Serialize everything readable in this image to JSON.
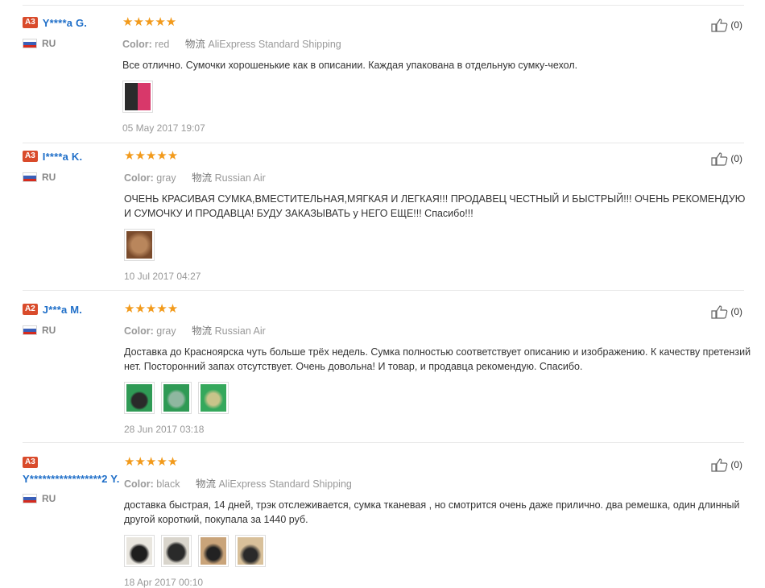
{
  "reviews": [
    {
      "level": "A3",
      "name": "Y****a G.",
      "country": "RU",
      "stars": "★★★★★",
      "color_label": "Color:",
      "color_value": "red",
      "shipping_label": "物流",
      "shipping_value": "AliExpress Standard Shipping",
      "text": "Все отлично. Сумочки хорошенькие как в описании. Каждая упакована в отдельную сумку-чехол.",
      "date": "05 May 2017 19:07",
      "helpful": "(0)"
    },
    {
      "level": "A3",
      "name": "I****a K.",
      "country": "RU",
      "stars": "★★★★★",
      "color_label": "Color:",
      "color_value": "gray",
      "shipping_label": "物流",
      "shipping_value": "Russian Air",
      "text": "ОЧЕНЬ КРАСИВАЯ СУМКА,ВМЕСТИТЕЛЬНАЯ,МЯГКАЯ И ЛЕГКАЯ!!! ПРОДАВЕЦ ЧЕСТНЫЙ И БЫСТРЫЙ!!! ОЧЕНЬ РЕКОМЕНДУЮ И СУМОЧКУ И ПРОДАВЦА! БУДУ ЗАКАЗЫВАТЬ у НЕГО ЕЩЕ!!! Спасибо!!!",
      "date": "10 Jul 2017 04:27",
      "helpful": "(0)"
    },
    {
      "level": "A2",
      "name": "J***a M.",
      "country": "RU",
      "stars": "★★★★★",
      "color_label": "Color:",
      "color_value": "gray",
      "shipping_label": "物流",
      "shipping_value": "Russian Air",
      "text": "Доставка до Красноярска чуть больше трёх недель. Сумка полностью соответствует описанию и изображению. К качеству претензий нет. Посторонний запах отсутствует. Очень довольна! И товар, и продавца рекомендую. Спасибо.",
      "date": "28 Jun 2017 03:18",
      "helpful": "(0)"
    },
    {
      "level": "A3",
      "name": "Y*****************2 Y.",
      "country": "RU",
      "stars": "★★★★★",
      "color_label": "Color:",
      "color_value": "black",
      "shipping_label": "物流",
      "shipping_value": "AliExpress Standard Shipping",
      "text": "доставка быстрая, 14 дней, трэк отслеживается, сумка тканевая , но смотрится очень даже прилично. два ремешка, один длинный другой короткий, покупала за 1440 руб.",
      "date": "18 Apr 2017 00:10",
      "helpful": "(0)"
    }
  ],
  "colors": {
    "username": "#1e6ec8",
    "badge": "#d94b2b",
    "stars": "#f29a1b",
    "muted": "#999999"
  }
}
